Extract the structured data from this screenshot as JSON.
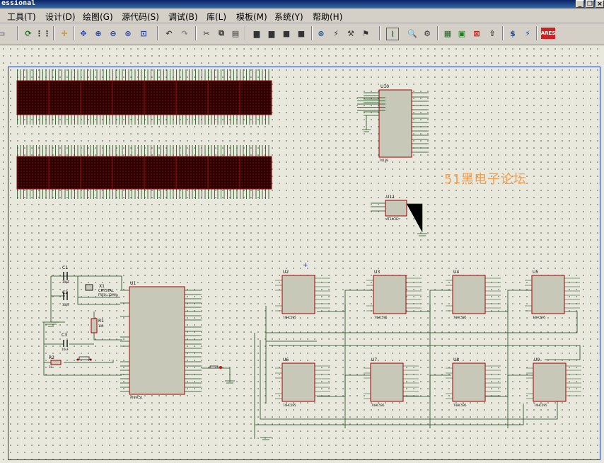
{
  "window": {
    "title": "essional"
  },
  "menu": [
    {
      "label": "工具(T)"
    },
    {
      "label": "设计(D)"
    },
    {
      "label": "绘图(G)"
    },
    {
      "label": "源代码(S)"
    },
    {
      "label": "调试(B)"
    },
    {
      "label": "库(L)"
    },
    {
      "label": "模板(M)"
    },
    {
      "label": "系统(Y)"
    },
    {
      "label": "帮助(H)"
    }
  ],
  "toolbar_icons": [
    "refresh",
    "grid",
    "origin",
    "pan",
    "zoom-in",
    "zoom-out",
    "zoom-all",
    "zoom-area",
    "undo",
    "redo",
    "cut",
    "copy",
    "paste",
    "block-copy",
    "block-move",
    "block-rotate",
    "block-delete",
    "pick",
    "make-device",
    "packaging",
    "decompose",
    "wire-autorouter",
    "search",
    "property-assign",
    "design-explorer",
    "new-sheet",
    "remove-sheet",
    "goto-parent",
    "bill-of-materials",
    "electrical-rules-check",
    "ares"
  ],
  "watermark": "51黑电子论坛",
  "components": {
    "u10": {
      "ref": "U10",
      "part": "74138"
    },
    "u11": {
      "ref": "U11",
      "part": "AT24C02"
    },
    "u1": {
      "ref": "U1",
      "part": "AT89C51"
    },
    "c1": {
      "ref": "C1",
      "value": "30pF"
    },
    "c2": {
      "ref": "C2",
      "value": "30pF"
    },
    "c3": {
      "ref": "C3",
      "value": "10uF"
    },
    "x1": {
      "ref": "X1",
      "value": "CRYSTAL",
      "freq": "FREQ=12MHz"
    },
    "r1": {
      "ref": "R1",
      "value": "10k"
    },
    "r2": {
      "ref": "R2",
      "value": "1k"
    },
    "shift_regs": [
      {
        "ref": "U2",
        "part": "74HC595"
      },
      {
        "ref": "U3",
        "part": "74HC595"
      },
      {
        "ref": "U4",
        "part": "74HC595"
      },
      {
        "ref": "U5",
        "part": "74HC595"
      },
      {
        "ref": "U6",
        "part": "74HC595"
      },
      {
        "ref": "U7",
        "part": "74HC595"
      },
      {
        "ref": "U8",
        "part": "74HC595"
      },
      {
        "ref": "U9",
        "part": "74HC595"
      }
    ]
  },
  "colors": {
    "led_matrix": "#3a0000",
    "led_border": "#9a1010",
    "wire": "#005000",
    "part_body": "#c8c8b8",
    "part_border": "#a00000",
    "sheet_border": "#1a3a9a"
  }
}
